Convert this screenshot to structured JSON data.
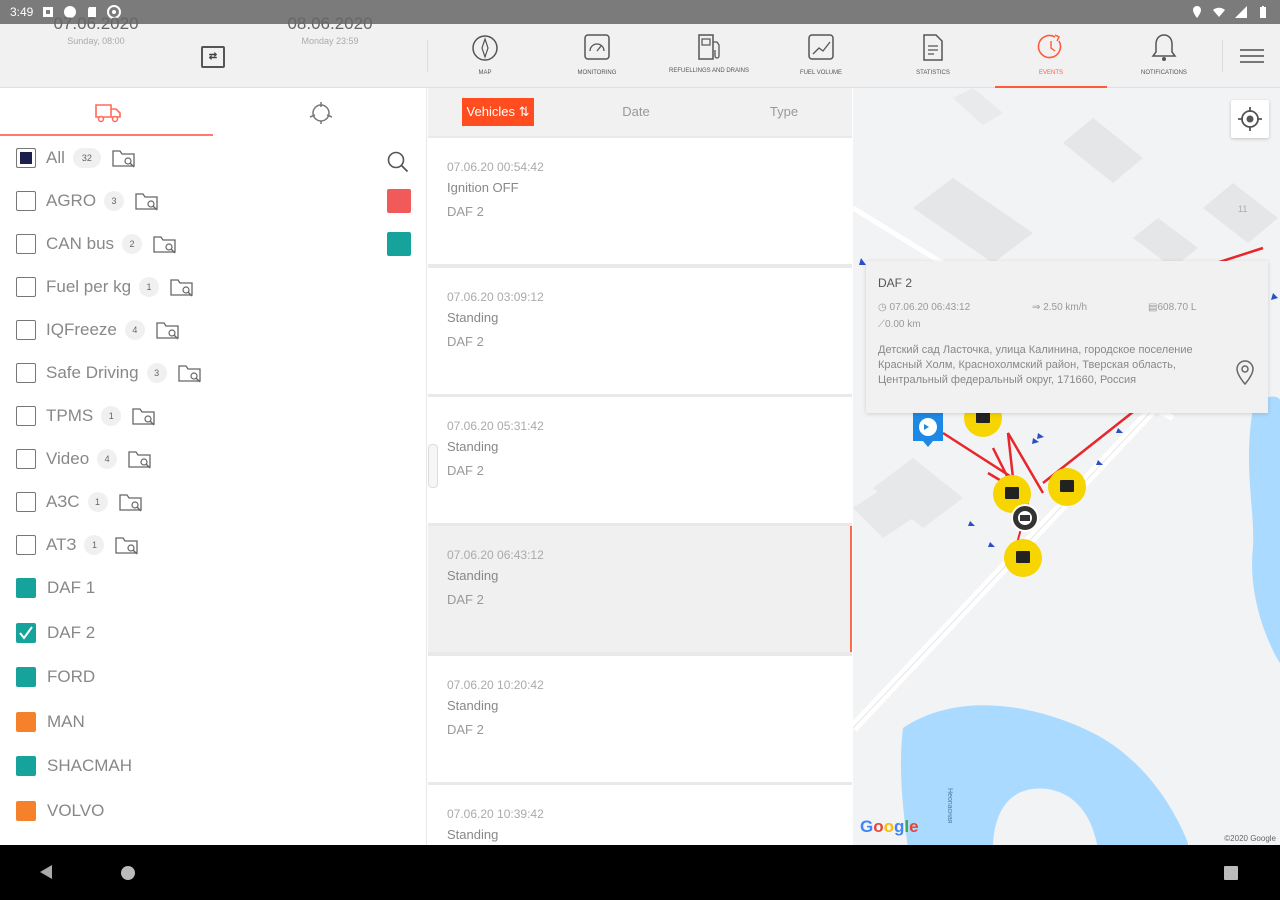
{
  "status_bar": {
    "time": "3:49"
  },
  "header": {
    "date_from": {
      "date": "07.06.2020",
      "sub": "Sunday, 08:00"
    },
    "date_to": {
      "date": "08.06.2020",
      "sub": "Monday 23:59"
    },
    "swap_label": "⇄",
    "tabs": [
      {
        "label": "MAP",
        "icon": "compass-icon"
      },
      {
        "label": "MONITORING",
        "icon": "gauge-icon"
      },
      {
        "label": "REFUELLINGS AND DRAINS",
        "icon": "fuel-icon"
      },
      {
        "label": "FUEL VOLUME",
        "icon": "chart-icon"
      },
      {
        "label": "STATISTICS",
        "icon": "document-icon"
      },
      {
        "label": "EVENTS",
        "icon": "clock-icon",
        "active": true
      },
      {
        "label": "NOTIFICATIONS",
        "icon": "bell-icon"
      }
    ]
  },
  "groups": [
    {
      "name": "All",
      "count": "32",
      "checked": "filled"
    },
    {
      "name": "AGRO",
      "count": "3",
      "swatch": "#f25a5a"
    },
    {
      "name": "CAN bus",
      "count": "2",
      "swatch": "#15a39b"
    },
    {
      "name": "Fuel per kg",
      "count": "1"
    },
    {
      "name": "IQFreeze",
      "count": "4"
    },
    {
      "name": "Safe Driving",
      "count": "3"
    },
    {
      "name": "TPMS",
      "count": "1"
    },
    {
      "name": "Video",
      "count": "4"
    },
    {
      "name": "АЗС",
      "count": "1"
    },
    {
      "name": "АТЗ",
      "count": "1"
    }
  ],
  "vehicles": [
    {
      "name": "DAF 1",
      "color": "#15a39b"
    },
    {
      "name": "DAF 2",
      "color": "#15a39b",
      "checked": true
    },
    {
      "name": "FORD",
      "color": "#15a39b"
    },
    {
      "name": "MAN",
      "color": "#f5822a"
    },
    {
      "name": "SHACMAH",
      "color": "#15a39b"
    },
    {
      "name": "VOLVO",
      "color": "#f5822a"
    }
  ],
  "filter_tabs": {
    "vehicles": "Vehicles ⇅",
    "date": "Date",
    "type": "Type"
  },
  "events": [
    {
      "time": "07.06.20 00:54:42",
      "kind": "Ignition OFF",
      "vehicle": "DAF 2"
    },
    {
      "time": "07.06.20 03:09:12",
      "kind": "Standing",
      "vehicle": "DAF 2"
    },
    {
      "time": "07.06.20 05:31:42",
      "kind": "Standing",
      "vehicle": "DAF 2"
    },
    {
      "time": "07.06.20 06:43:12",
      "kind": "Standing",
      "vehicle": "DAF 2",
      "selected": true
    },
    {
      "time": "07.06.20 10:20:42",
      "kind": "Standing",
      "vehicle": "DAF 2"
    },
    {
      "time": "07.06.20 10:39:42",
      "kind": "Standing",
      "vehicle": ""
    }
  ],
  "popup": {
    "title": "DAF 2",
    "time": "07.06.20 06:43:12",
    "speed": "2.50 km/h",
    "fuel": "608.70 L",
    "distance": "0.00 km",
    "address": "Детский сад  Ласточка, улица Калинина, городское поселение Красный Холм, Краснохолмский район, Тверская область, Центральный федеральный округ, 171660, Россия"
  },
  "map": {
    "google_label": "Google",
    "copyright": "©2020 Google",
    "river_label": "Неопасная",
    "grid_number": "11"
  },
  "colors": {
    "accent": "#ff5a3c",
    "teal": "#15a39b",
    "orange": "#f5822a",
    "red": "#f25a5a",
    "water": "#aadaff",
    "marker": "#f6d500"
  }
}
